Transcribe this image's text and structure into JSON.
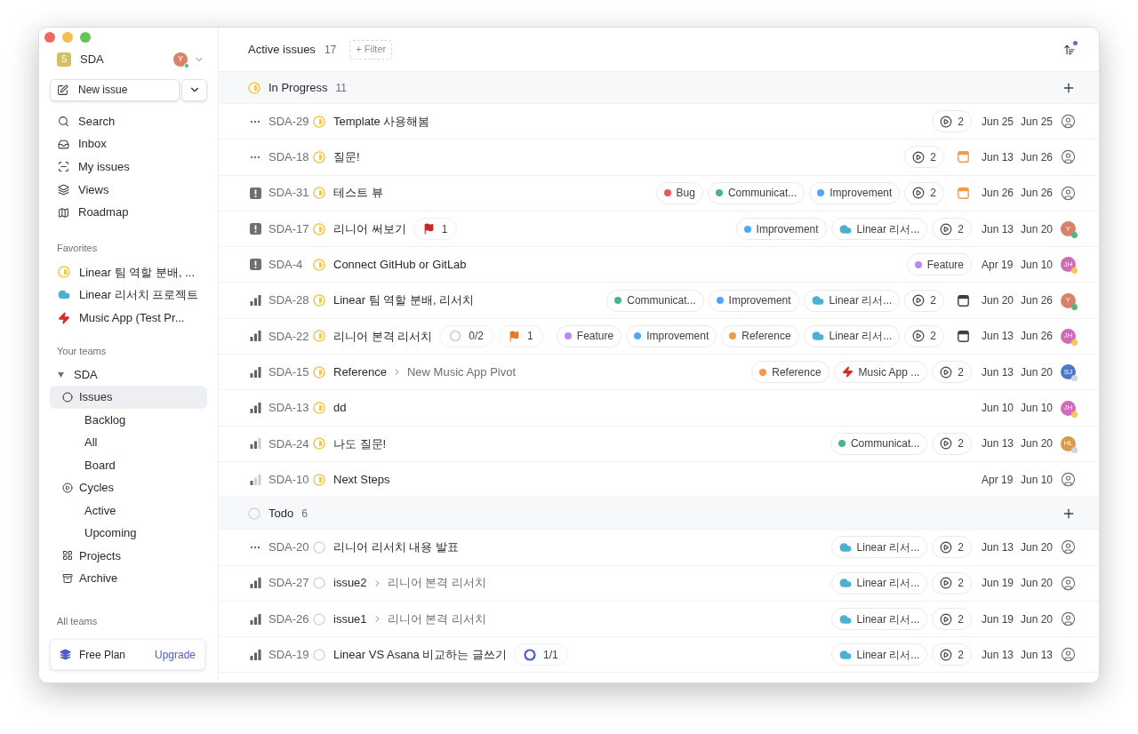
{
  "sidebar": {
    "workspace": {
      "initial": "S",
      "name": "SDA",
      "avatar": "Y"
    },
    "new_issue": "New issue",
    "nav": [
      {
        "kind": "search",
        "label": "Search"
      },
      {
        "kind": "inbox",
        "label": "Inbox"
      },
      {
        "kind": "my",
        "label": "My issues"
      },
      {
        "kind": "views",
        "label": "Views"
      },
      {
        "kind": "roadmap",
        "label": "Roadmap"
      }
    ],
    "favorites_title": "Favorites",
    "favorites": [
      {
        "kind": "started",
        "label": "Linear 팀 역할 분배, ..."
      },
      {
        "kind": "cloud",
        "label": "Linear 리서치 프로젝트"
      },
      {
        "kind": "bolt",
        "label": "Music App (Test Pr..."
      }
    ],
    "teams_title": "Your teams",
    "team": {
      "name": "SDA",
      "expanded": true,
      "items": [
        {
          "kind": "issues",
          "label": "Issues",
          "selected": true,
          "children": [
            {
              "label": "Backlog",
              "selected": false
            },
            {
              "label": "All",
              "selected": false
            },
            {
              "label": "Board",
              "selected": false
            }
          ]
        },
        {
          "kind": "cycles",
          "label": "Cycles",
          "selected": false,
          "children": [
            {
              "label": "Active",
              "selected": false
            },
            {
              "label": "Upcoming",
              "selected": false
            }
          ]
        },
        {
          "kind": "projects",
          "label": "Projects",
          "selected": false
        },
        {
          "kind": "archive",
          "label": "Archive",
          "selected": false
        }
      ]
    },
    "all_teams_title": "All teams",
    "plan": {
      "name": "Free Plan",
      "action": "Upgrade"
    }
  },
  "header": {
    "title": "Active issues",
    "count": "17",
    "filter": "+ Filter"
  },
  "groups": [
    {
      "kind": "started",
      "name": "In Progress",
      "count": "11",
      "rows": [
        {
          "priority": {
            "kind": "none"
          },
          "id": "SDA-29",
          "status": {
            "kind": "started"
          },
          "title": "Template 사용해봄",
          "chips": [
            {
              "kind": "cycle",
              "text": "2"
            }
          ],
          "start": "Jun 25",
          "end": "Jun 25",
          "assignee": {
            "kind": "none"
          }
        },
        {
          "priority": {
            "kind": "none"
          },
          "id": "SDA-18",
          "status": {
            "kind": "started"
          },
          "title": "질문!",
          "chips": [
            {
              "kind": "cycle",
              "text": "2"
            }
          ],
          "due": {
            "color": "#f2994a"
          },
          "start": "Jun 13",
          "end": "Jun 26",
          "assignee": {
            "kind": "none"
          }
        },
        {
          "priority": {
            "kind": "urgent"
          },
          "id": "SDA-31",
          "status": {
            "kind": "started"
          },
          "title": "테스트 뷰",
          "chips": [
            {
              "kind": "label",
              "color": "#eb5757",
              "text": "Bug"
            },
            {
              "kind": "label",
              "color": "#4cb782",
              "text": "Communicat..."
            },
            {
              "kind": "label",
              "color": "#4ea7fc",
              "text": "Improvement"
            },
            {
              "kind": "cycle",
              "text": "2"
            }
          ],
          "due": {
            "color": "#f2994a"
          },
          "start": "Jun 26",
          "end": "Jun 26",
          "assignee": {
            "kind": "none"
          }
        },
        {
          "priority": {
            "kind": "urgent"
          },
          "id": "SDA-17",
          "status": {
            "kind": "started"
          },
          "title": "리니어 써보기",
          "badges": [
            {
              "kind": "flag",
              "color": "#c52828",
              "text": "1"
            }
          ],
          "chips": [
            {
              "kind": "label",
              "color": "#4ea7fc",
              "text": "Improvement"
            },
            {
              "kind": "cloud",
              "text": "Linear 리서..."
            },
            {
              "kind": "cycle",
              "text": "2"
            }
          ],
          "start": "Jun 13",
          "end": "Jun 20",
          "assignee": {
            "kind": "user",
            "initials": "Y",
            "color": "#d9826a",
            "presence": {
              "color": "#4cb782"
            }
          }
        },
        {
          "priority": {
            "kind": "urgent"
          },
          "id": "SDA-4",
          "status": {
            "kind": "started"
          },
          "title": "Connect GitHub or GitLab",
          "chips": [
            {
              "kind": "label",
              "color": "#bb87fc",
              "text": "Feature"
            }
          ],
          "start": "Apr 19",
          "end": "Jun 10",
          "assignee": {
            "kind": "user",
            "initials": "JH",
            "color": "#d16bb5",
            "presence": {
              "color": "#f2c94c"
            }
          }
        },
        {
          "priority": {
            "kind": "high"
          },
          "id": "SDA-28",
          "status": {
            "kind": "started"
          },
          "title": "Linear 팀 역할 분배, 리서치",
          "chips": [
            {
              "kind": "label",
              "color": "#4cb782",
              "text": "Communicat..."
            },
            {
              "kind": "label",
              "color": "#4ea7fc",
              "text": "Improvement"
            },
            {
              "kind": "cloud",
              "text": "Linear 리서..."
            },
            {
              "kind": "cycle",
              "text": "2"
            }
          ],
          "due": {
            "color": "#3c4149"
          },
          "start": "Jun 20",
          "end": "Jun 26",
          "assignee": {
            "kind": "user",
            "initials": "Y",
            "color": "#d9826a",
            "presence": {
              "color": "#4cb782"
            }
          }
        },
        {
          "priority": {
            "kind": "high"
          },
          "id": "SDA-22",
          "status": {
            "kind": "started"
          },
          "title": "리니어 본격 리서치",
          "badges": [
            {
              "kind": "progress",
              "color": "#d6d8dc",
              "text": "0/2"
            },
            {
              "kind": "flag",
              "color": "#e07a2f",
              "text": "1"
            }
          ],
          "chips": [
            {
              "kind": "label",
              "color": "#bb87fc",
              "text": "Feature"
            },
            {
              "kind": "label",
              "color": "#4ea7fc",
              "text": "Improvement"
            },
            {
              "kind": "label",
              "color": "#f2994a",
              "text": "Reference"
            },
            {
              "kind": "cloud",
              "text": "Linear 리서..."
            },
            {
              "kind": "cycle",
              "text": "2"
            }
          ],
          "due": {
            "color": "#3c4149"
          },
          "start": "Jun 13",
          "end": "Jun 26",
          "assignee": {
            "kind": "user",
            "initials": "JH",
            "color": "#d16bb5",
            "presence": {
              "color": "#f2c94c"
            }
          }
        },
        {
          "priority": {
            "kind": "high"
          },
          "id": "SDA-15",
          "status": {
            "kind": "started"
          },
          "title": "Reference",
          "parent": "New Music App Pivot",
          "chips": [
            {
              "kind": "label",
              "color": "#f2994a",
              "text": "Reference"
            },
            {
              "kind": "bolt",
              "text": "Music App ..."
            },
            {
              "kind": "cycle",
              "text": "2"
            }
          ],
          "start": "Jun 13",
          "end": "Jun 20",
          "assignee": {
            "kind": "user",
            "initials": "SJ",
            "color": "#4a79c9",
            "presence": {
              "color": "#d0d3d9"
            }
          }
        },
        {
          "priority": {
            "kind": "high"
          },
          "id": "SDA-13",
          "status": {
            "kind": "started"
          },
          "title": "dd",
          "start": "Jun 10",
          "end": "Jun 10",
          "assignee": {
            "kind": "user",
            "initials": "JH",
            "color": "#d16bb5",
            "presence": {
              "color": "#f2c94c"
            }
          }
        },
        {
          "priority": {
            "kind": "medium"
          },
          "id": "SDA-24",
          "status": {
            "kind": "started"
          },
          "title": "나도 질문!",
          "chips": [
            {
              "kind": "label",
              "color": "#4cb782",
              "text": "Communicat..."
            },
            {
              "kind": "cycle",
              "text": "2"
            }
          ],
          "start": "Jun 13",
          "end": "Jun 20",
          "assignee": {
            "kind": "user",
            "initials": "HL",
            "color": "#d99a4e",
            "presence": {
              "color": "#d0d3d9"
            }
          }
        },
        {
          "priority": {
            "kind": "low"
          },
          "id": "SDA-10",
          "status": {
            "kind": "started"
          },
          "title": "Next Steps",
          "start": "Apr 19",
          "end": "Jun 10",
          "assignee": {
            "kind": "none"
          }
        }
      ]
    },
    {
      "kind": "todo",
      "name": "Todo",
      "count": "6",
      "rows": [
        {
          "priority": {
            "kind": "none"
          },
          "id": "SDA-20",
          "status": {
            "kind": "todo"
          },
          "title": "리니어 리서치 내용 발표",
          "chips": [
            {
              "kind": "cloud",
              "text": "Linear 리서..."
            },
            {
              "kind": "cycle",
              "text": "2"
            }
          ],
          "start": "Jun 13",
          "end": "Jun 20",
          "assignee": {
            "kind": "none"
          }
        },
        {
          "priority": {
            "kind": "high"
          },
          "id": "SDA-27",
          "status": {
            "kind": "todo"
          },
          "title": "issue2",
          "parent": "리니어 본격 리서치",
          "chips": [
            {
              "kind": "cloud",
              "text": "Linear 리서..."
            },
            {
              "kind": "cycle",
              "text": "2"
            }
          ],
          "start": "Jun 19",
          "end": "Jun 20",
          "assignee": {
            "kind": "none"
          }
        },
        {
          "priority": {
            "kind": "high"
          },
          "id": "SDA-26",
          "status": {
            "kind": "todo"
          },
          "title": "issue1",
          "parent": "리니어 본격 리서치",
          "chips": [
            {
              "kind": "cloud",
              "text": "Linear 리서..."
            },
            {
              "kind": "cycle",
              "text": "2"
            }
          ],
          "start": "Jun 19",
          "end": "Jun 20",
          "assignee": {
            "kind": "none"
          }
        },
        {
          "priority": {
            "kind": "high"
          },
          "id": "SDA-19",
          "status": {
            "kind": "todo"
          },
          "title": "Linear VS Asana 비교하는 글쓰기",
          "badges": [
            {
              "kind": "progress",
              "color": "#4d5cc9",
              "text": "1/1"
            }
          ],
          "chips": [
            {
              "kind": "cloud",
              "text": "Linear 리서..."
            },
            {
              "kind": "cycle",
              "text": "2"
            }
          ],
          "start": "Jun 13",
          "end": "Jun 13",
          "assignee": {
            "kind": "none"
          }
        }
      ]
    }
  ]
}
